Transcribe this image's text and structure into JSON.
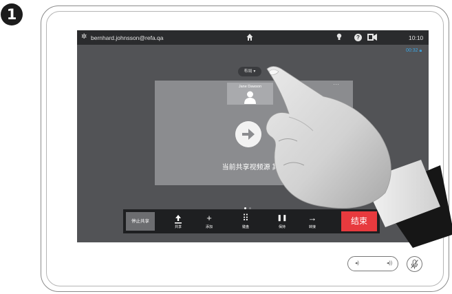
{
  "step_number": "1",
  "topbar": {
    "user": "bernhard.johnsson@refa.qa",
    "time": "10:10",
    "help_label": "?"
  },
  "call": {
    "duration": "00:32",
    "layout_label": "布局",
    "participant_name": "Jane Dawson",
    "more_label": "···",
    "share_caption": "当前共享视频源 其他"
  },
  "callbar": {
    "stop_share": "停止共享",
    "buttons": [
      {
        "icon": "upload-icon",
        "glyph": "⭱",
        "label": "共享"
      },
      {
        "icon": "add-icon",
        "glyph": "+",
        "label": "添加"
      },
      {
        "icon": "keypad-icon",
        "glyph": "⠿",
        "label": "键盘"
      },
      {
        "icon": "pause-icon",
        "glyph": "❚❚",
        "label": "保持"
      },
      {
        "icon": "transfer-icon",
        "glyph": "→",
        "label": "转接"
      }
    ],
    "end_call": "结束"
  },
  "hardware": {
    "vol_down_glyph": "◂)",
    "vol_up_glyph": "◂))"
  },
  "colors": {
    "screen_bg": "#525356",
    "topbar_bg": "#2a2b2d",
    "end_call": "#e73a3e",
    "duration": "#3aa8e8"
  }
}
